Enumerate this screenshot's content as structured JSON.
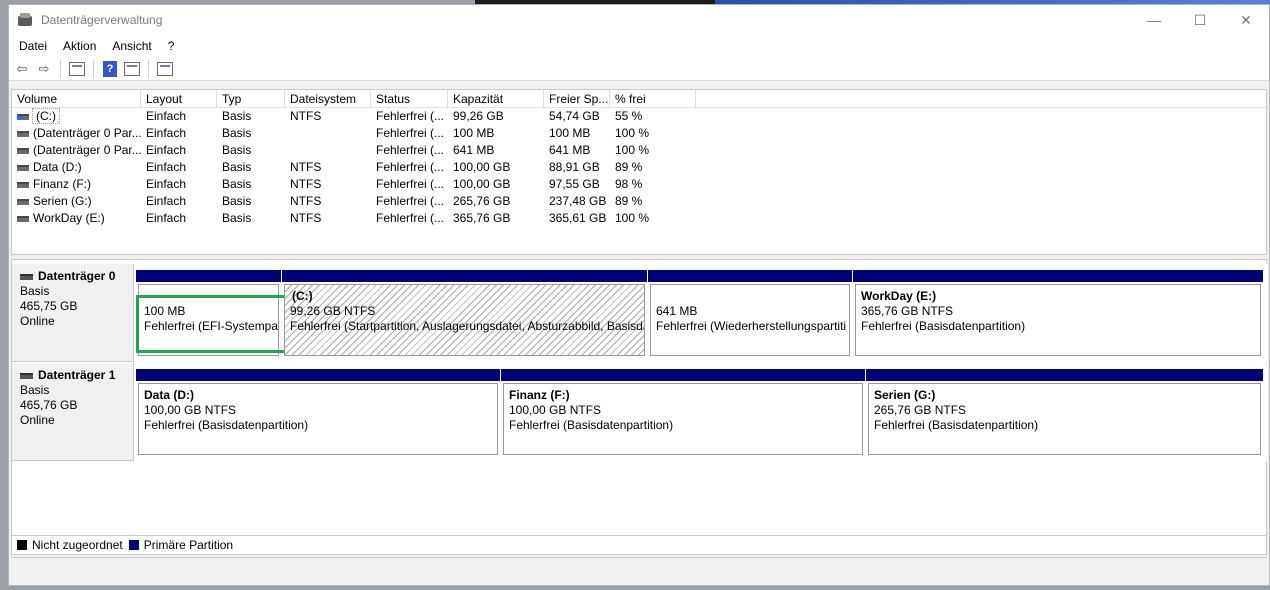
{
  "window": {
    "title": "Datenträgerverwaltung"
  },
  "controls": {
    "minimize": "—",
    "maximize": "☐",
    "close": "✕"
  },
  "menu": [
    "Datei",
    "Aktion",
    "Ansicht",
    "?"
  ],
  "toolbar": {
    "back": "⇦",
    "forward": "⇨",
    "help": "?"
  },
  "volume_list": {
    "columns": [
      "Volume",
      "Layout",
      "Typ",
      "Dateisystem",
      "Status",
      "Kapazität",
      "Freier Sp...",
      "% frei"
    ],
    "rows": [
      {
        "volume": "(C:)",
        "layout": "Einfach",
        "typ": "Basis",
        "fs": "NTFS",
        "status": "Fehlerfrei (...",
        "cap": "99,26 GB",
        "free": "54,74 GB",
        "pct": "55 %"
      },
      {
        "volume": "(Datenträger 0 Par...",
        "layout": "Einfach",
        "typ": "Basis",
        "fs": "",
        "status": "Fehlerfrei (...",
        "cap": "100 MB",
        "free": "100 MB",
        "pct": "100 %"
      },
      {
        "volume": "(Datenträger 0 Par...",
        "layout": "Einfach",
        "typ": "Basis",
        "fs": "",
        "status": "Fehlerfrei (...",
        "cap": "641 MB",
        "free": "641 MB",
        "pct": "100 %"
      },
      {
        "volume": "Data (D:)",
        "layout": "Einfach",
        "typ": "Basis",
        "fs": "NTFS",
        "status": "Fehlerfrei (...",
        "cap": "100,00 GB",
        "free": "88,91 GB",
        "pct": "89 %"
      },
      {
        "volume": "Finanz (F:)",
        "layout": "Einfach",
        "typ": "Basis",
        "fs": "NTFS",
        "status": "Fehlerfrei (...",
        "cap": "100,00 GB",
        "free": "97,55 GB",
        "pct": "98 %"
      },
      {
        "volume": "Serien (G:)",
        "layout": "Einfach",
        "typ": "Basis",
        "fs": "NTFS",
        "status": "Fehlerfrei (...",
        "cap": "265,76 GB",
        "free": "237,48 GB",
        "pct": "89 %"
      },
      {
        "volume": "WorkDay (E:)",
        "layout": "Einfach",
        "typ": "Basis",
        "fs": "NTFS",
        "status": "Fehlerfrei (...",
        "cap": "365,76 GB",
        "free": "365,61 GB",
        "pct": "100 %"
      }
    ]
  },
  "disks": [
    {
      "name": "Datenträger 0",
      "type": "Basis",
      "size": "465,75 GB",
      "state": "Online",
      "partitions": [
        {
          "name": "",
          "size": "100 MB",
          "status": "Fehlerfrei (EFI-Systempar"
        },
        {
          "name": "(C:)",
          "size": "99,26 GB NTFS",
          "status": "Fehlerfrei (Startpartition, Auslagerungsdatei, Absturzabbild, Basisda"
        },
        {
          "name": "",
          "size": "641 MB",
          "status": "Fehlerfrei (Wiederherstellungspartiti"
        },
        {
          "name": "WorkDay  (E:)",
          "size": "365,76 GB NTFS",
          "status": "Fehlerfrei (Basisdatenpartition)"
        }
      ]
    },
    {
      "name": "Datenträger 1",
      "type": "Basis",
      "size": "465,76 GB",
      "state": "Online",
      "partitions": [
        {
          "name": "Data  (D:)",
          "size": "100,00 GB NTFS",
          "status": "Fehlerfrei (Basisdatenpartition)"
        },
        {
          "name": "Finanz  (F:)",
          "size": "100,00 GB NTFS",
          "status": "Fehlerfrei (Basisdatenpartition)"
        },
        {
          "name": "Serien  (G:)",
          "size": "265,76 GB NTFS",
          "status": "Fehlerfrei (Basisdatenpartition)"
        }
      ]
    }
  ],
  "legend": {
    "unallocated": "Nicht zugeordnet",
    "unallocated_color": "#000000",
    "primary": "Primäre Partition",
    "primary_color": "#00007b"
  }
}
